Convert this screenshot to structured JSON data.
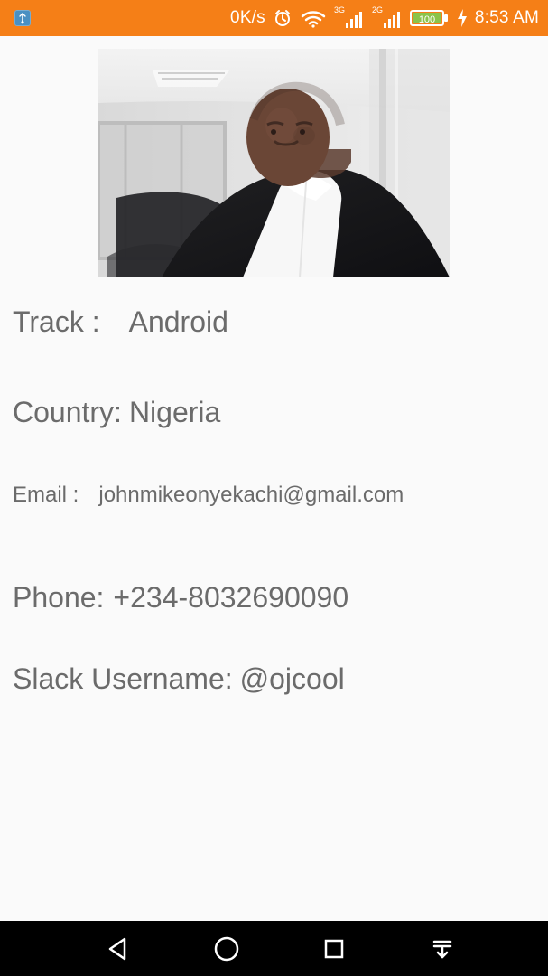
{
  "status_bar": {
    "speed": "0K/s",
    "network_3g": "3G",
    "network_2g": "2G",
    "battery": "100",
    "time": "8:53 AM",
    "colors": {
      "background": "#f57f17",
      "foreground": "#ffffff"
    },
    "icons": [
      "usb-debug-icon",
      "alarm-icon",
      "wifi-icon",
      "signal-3g-icon",
      "signal-2g-icon",
      "battery-icon",
      "charging-bolt-icon"
    ]
  },
  "profile": {
    "track_label": "Track :",
    "track_value": "Android",
    "country_label": "Country:",
    "country_value": "Nigeria",
    "email_label": "Email :",
    "email_value": "johnmikeonyekachi@gmail.com",
    "phone_label": "Phone:",
    "phone_value": "+234-8032690090",
    "slack_label": "Slack Username:",
    "slack_value": "@ojcool",
    "text_color": "#6b6b6b"
  },
  "navigation_bar": {
    "icons": [
      "back-icon",
      "home-icon",
      "recents-icon",
      "notification-pull-icon"
    ],
    "background": "#000000"
  }
}
